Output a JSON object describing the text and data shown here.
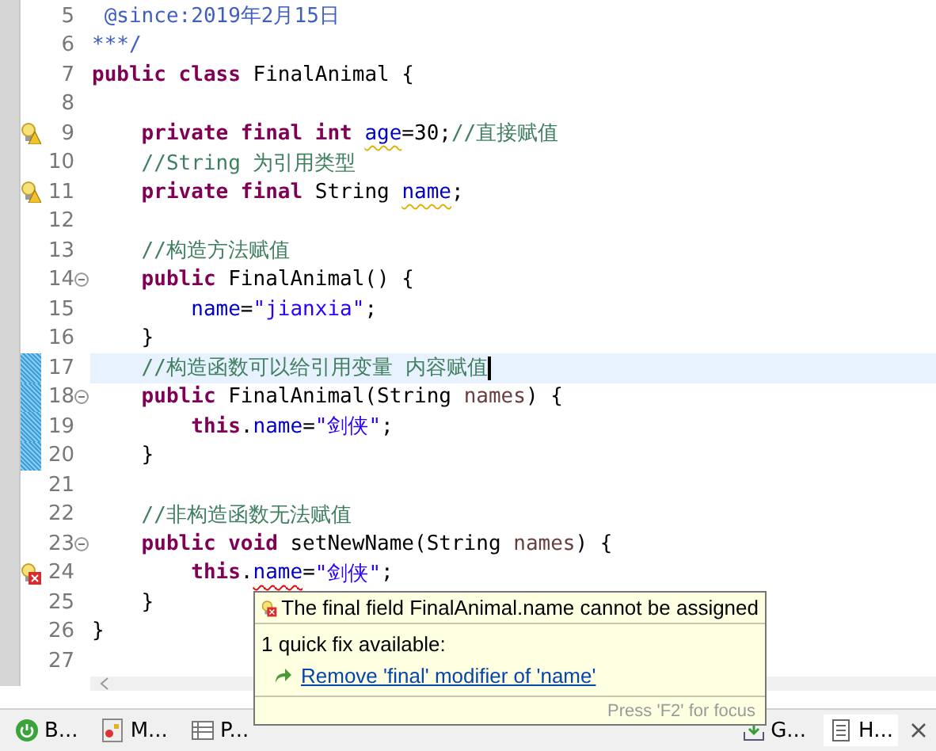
{
  "editor": {
    "lines": [
      {
        "number": "5",
        "changed": false,
        "current": false,
        "tokens": [
          {
            "kind": "javadoc",
            "text": " @since:2019年2月15日"
          }
        ]
      },
      {
        "number": "6",
        "changed": false,
        "current": false,
        "tokens": [
          {
            "kind": "javadoc",
            "text": "***/"
          }
        ]
      },
      {
        "number": "7",
        "changed": false,
        "current": false,
        "tokens": [
          {
            "kind": "keyword",
            "text": "public class "
          },
          {
            "kind": "plain",
            "text": "FinalAnimal {"
          }
        ]
      },
      {
        "number": "8",
        "changed": false,
        "current": false
      },
      {
        "number": "9",
        "warning": true,
        "changed": false,
        "current": false,
        "tokens": [
          {
            "kind": "keyword",
            "text": "    private final int "
          },
          {
            "kind": "field",
            "text": "age",
            "warning": true
          },
          {
            "kind": "plain",
            "text": "=30;"
          },
          {
            "kind": "comment",
            "text": "//直接赋值"
          }
        ]
      },
      {
        "number": "10",
        "changed": false,
        "current": false,
        "tokens": [
          {
            "kind": "comment",
            "text": "    //String 为引用类型"
          }
        ]
      },
      {
        "number": "11",
        "warning": true,
        "changed": false,
        "current": false,
        "tokens": [
          {
            "kind": "keyword",
            "text": "    private final "
          },
          {
            "kind": "plain",
            "text": "String "
          },
          {
            "kind": "field",
            "text": "name",
            "warning": true
          },
          {
            "kind": "plain",
            "text": ";"
          }
        ]
      },
      {
        "number": "12",
        "changed": false,
        "current": false
      },
      {
        "number": "13",
        "changed": false,
        "current": false,
        "tokens": [
          {
            "kind": "comment",
            "text": "    //构造方法赋值"
          }
        ]
      },
      {
        "number": "14",
        "expanded": true,
        "changed": false,
        "current": false,
        "tokens": [
          {
            "kind": "keyword",
            "text": "    public "
          },
          {
            "kind": "plain",
            "text": "FinalAnimal() {"
          }
        ]
      },
      {
        "number": "15",
        "changed": false,
        "current": false,
        "tokens": [
          {
            "kind": "field",
            "text": "        name"
          },
          {
            "kind": "plain",
            "text": "="
          },
          {
            "kind": "string",
            "text": "\"jianxia\""
          },
          {
            "kind": "plain",
            "text": ";"
          }
        ]
      },
      {
        "number": "16",
        "changed": false,
        "current": false,
        "tokens": [
          {
            "kind": "plain",
            "text": "    }"
          }
        ]
      },
      {
        "number": "17",
        "changed": true,
        "current": true,
        "tokens": [
          {
            "kind": "comment",
            "text": "    //构造函数可以给引用变量 内容赋值"
          }
        ]
      },
      {
        "number": "18",
        "expanded": true,
        "changed": true,
        "current": false,
        "tokens": [
          {
            "kind": "keyword",
            "text": "    public "
          },
          {
            "kind": "plain",
            "text": "FinalAnimal(String "
          },
          {
            "kind": "param",
            "text": "names"
          },
          {
            "kind": "plain",
            "text": ") {"
          }
        ]
      },
      {
        "number": "19",
        "changed": true,
        "current": false,
        "tokens": [
          {
            "kind": "keyword",
            "text": "        this"
          },
          {
            "kind": "plain",
            "text": "."
          },
          {
            "kind": "field",
            "text": "name"
          },
          {
            "kind": "plain",
            "text": "="
          },
          {
            "kind": "string",
            "text": "\"剑侠\""
          },
          {
            "kind": "plain",
            "text": ";"
          }
        ]
      },
      {
        "number": "20",
        "changed": true,
        "current": false,
        "tokens": [
          {
            "kind": "plain",
            "text": "    }"
          }
        ]
      },
      {
        "number": "21",
        "changed": false,
        "current": false
      },
      {
        "number": "22",
        "changed": false,
        "current": false,
        "tokens": [
          {
            "kind": "comment",
            "text": "    //非构造函数无法赋值"
          }
        ]
      },
      {
        "number": "23",
        "expanded": true,
        "changed": false,
        "current": false,
        "tokens": [
          {
            "kind": "keyword",
            "text": "    public void "
          },
          {
            "kind": "plain",
            "text": "setNewName(String "
          },
          {
            "kind": "param",
            "text": "names"
          },
          {
            "kind": "plain",
            "text": ") {"
          }
        ]
      },
      {
        "number": "24",
        "error": true,
        "changed": false,
        "current": false,
        "tokens": [
          {
            "kind": "keyword",
            "text": "        this"
          },
          {
            "kind": "plain",
            "text": "."
          },
          {
            "kind": "field",
            "text": "name",
            "error": true
          },
          {
            "kind": "plain",
            "text": "="
          },
          {
            "kind": "string",
            "text": "\"剑侠\""
          },
          {
            "kind": "plain",
            "text": ";"
          }
        ]
      },
      {
        "number": "25",
        "changed": false,
        "current": false,
        "tokens": [
          {
            "kind": "plain",
            "text": "    }"
          }
        ]
      },
      {
        "number": "26",
        "changed": false,
        "current": false,
        "tokens": [
          {
            "kind": "plain",
            "text": "}"
          }
        ]
      },
      {
        "number": "27",
        "changed": false,
        "current": false
      }
    ]
  },
  "hover": {
    "title": "The final field FinalAnimal.name cannot be assigned",
    "subtitle": "1 quick fix available:",
    "fixes": [
      "Remove 'final' modifier of 'name'"
    ],
    "footer": "Press 'F2' for focus"
  },
  "views": [
    {
      "label": "B...",
      "kind": "power",
      "selected": false
    },
    {
      "label": "M...",
      "kind": "markers",
      "selected": false
    },
    {
      "label": "P...",
      "kind": "table",
      "selected": false
    },
    {
      "label": "G...",
      "kind": "download",
      "selected": false
    },
    {
      "label": "H...",
      "kind": "doc",
      "selected": true
    }
  ]
}
